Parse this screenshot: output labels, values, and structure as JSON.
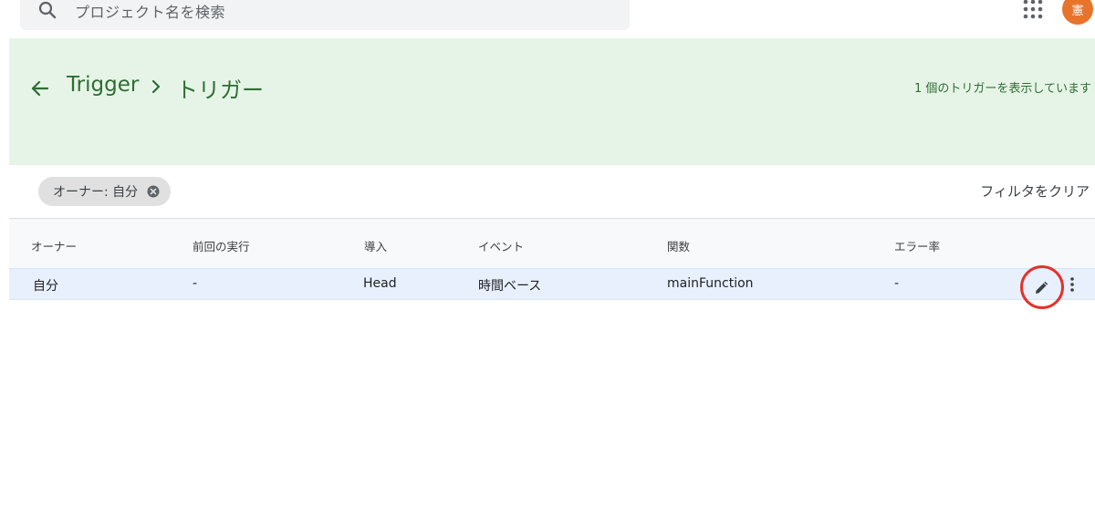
{
  "search": {
    "placeholder": "プロジェクト名を検索"
  },
  "account": {
    "avatar_initial": "憲",
    "avatar_color": "#e8742c"
  },
  "header": {
    "project": "Trigger",
    "current": "トリガー",
    "count_text": "1 個のトリガーを表示しています",
    "band_color": "#e6f4e7",
    "text_color": "#2e6e32"
  },
  "filter": {
    "chip_label": "オーナー: 自分",
    "clear_label": "フィルタをクリア"
  },
  "table": {
    "columns": [
      "オーナー",
      "前回の実行",
      "導入",
      "イベント",
      "関数",
      "エラー率"
    ],
    "rows": [
      {
        "owner": "自分",
        "last_run": "-",
        "deployment": "Head",
        "event": "時間ベース",
        "function": "mainFunction",
        "error_rate": "-"
      }
    ],
    "row_highlight_color": "#e8f0fe",
    "edit_highlight_color": "#e2332a"
  }
}
